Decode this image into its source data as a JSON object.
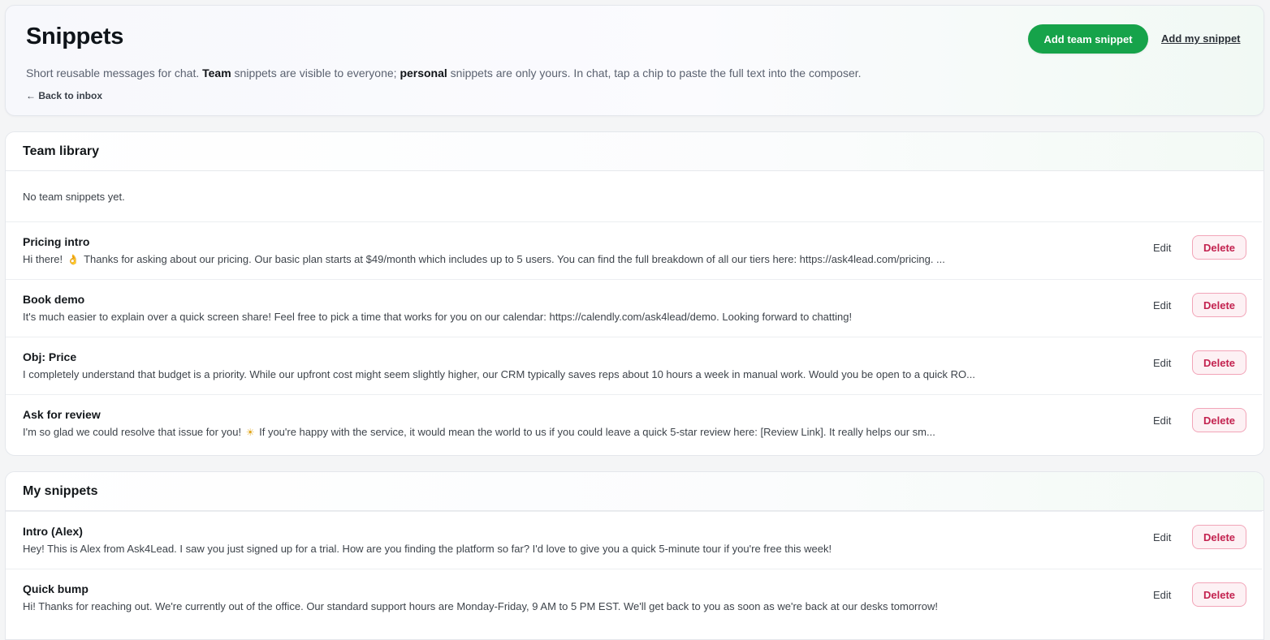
{
  "header": {
    "title": "Snippets",
    "desc_1": "Short reusable messages for chat. ",
    "desc_team": "Team",
    "desc_2": " snippets are visible to everyone; ",
    "desc_personal": "personal",
    "desc_3": " snippets are only yours. In chat, tap a chip to paste the full text into the composer.",
    "back_label": "← Back to inbox",
    "add_team_label": "Add team snippet",
    "add_mine_label": "Add my snippet"
  },
  "team": {
    "heading": "Team library",
    "empty_text": "No team snippets yet.",
    "items": [
      {
        "title": "Pricing intro",
        "text_before": "Hi there! ",
        "emoji": "👌",
        "text_after": " Thanks for asking about our pricing. Our basic plan starts at $49/month which includes up to 5 users. You can find the full breakdown of all our tiers here: https://ask4lead.com/pricing. ..."
      },
      {
        "title": "Book demo",
        "text_before": "It's much easier to explain over a quick screen share! Feel free to pick a time that works for you on our calendar: https://calendly.com/ask4lead/demo. Looking forward to chatting!",
        "emoji": "",
        "text_after": ""
      },
      {
        "title": "Obj: Price",
        "text_before": "I completely understand that budget is a priority. While our upfront cost might seem slightly higher, our CRM typically saves reps about 10 hours a week in manual work. Would you be open to a quick RO...",
        "emoji": "",
        "text_after": ""
      },
      {
        "title": "Ask for review",
        "text_before": "I'm so glad we could resolve that issue for you! ",
        "emoji": "☀",
        "text_after": " If you're happy with the service, it would mean the world to us if you could leave a quick 5-star review here: [Review Link]. It really helps our sm..."
      }
    ]
  },
  "mine": {
    "heading": "My snippets",
    "items": [
      {
        "title": "Intro (Alex)",
        "text_before": "Hey! This is Alex from Ask4Lead. I saw you just signed up for a trial. How are you finding the platform so far? I'd love to give you a quick 5-minute tour if you're free this week!",
        "emoji": "",
        "text_after": ""
      },
      {
        "title": "Quick bump",
        "text_before": "Hi! Thanks for reaching out. We're currently out of the office. Our standard support hours are Monday-Friday, 9 AM to 5 PM EST. We'll get back to you as soon as we're back at our desks tomorrow!",
        "emoji": "",
        "text_after": ""
      }
    ]
  },
  "actions": {
    "edit_label": "Edit",
    "delete_label": "Delete"
  },
  "colors": {
    "primary_green": "#16a34a",
    "delete_red": "#c3224f",
    "delete_bg": "#fdf1f4"
  }
}
